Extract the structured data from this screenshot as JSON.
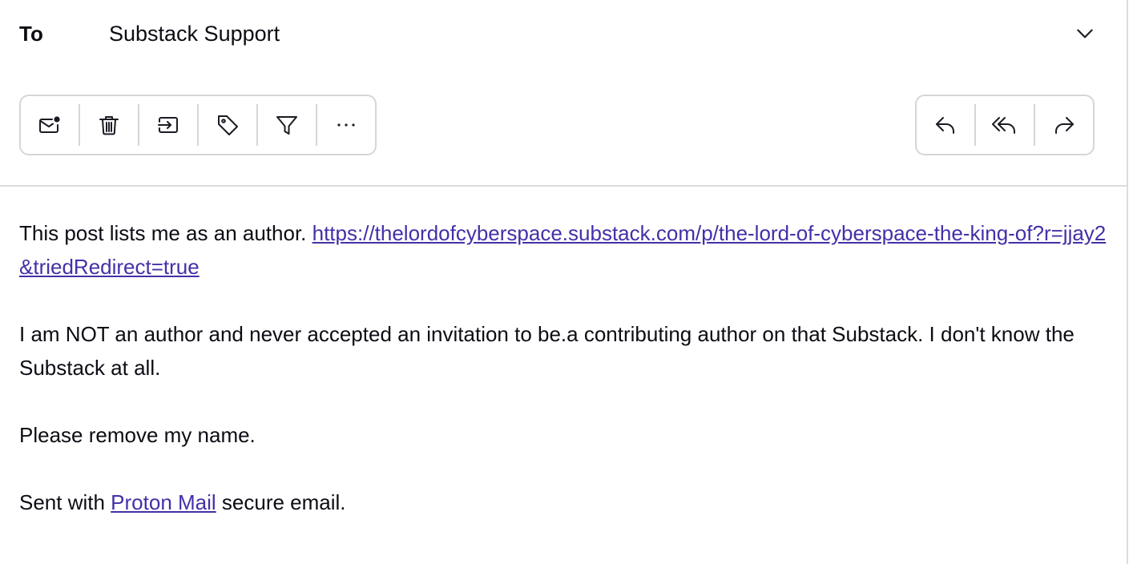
{
  "header": {
    "to_label": "To",
    "to_value": "Substack Support",
    "expand_icon": "chevron-down-icon"
  },
  "toolbar_left": [
    {
      "name": "mark-unread-button",
      "icon": "envelope-dot-icon",
      "label": "Mark as unread"
    },
    {
      "name": "trash-button",
      "icon": "trash-icon",
      "label": "Move to trash"
    },
    {
      "name": "move-button",
      "icon": "move-to-folder-icon",
      "label": "Move to"
    },
    {
      "name": "label-button",
      "icon": "tag-icon",
      "label": "Label as"
    },
    {
      "name": "filter-button",
      "icon": "filter-icon",
      "label": "Filter"
    },
    {
      "name": "more-button",
      "icon": "more-dots-icon",
      "label": "More"
    }
  ],
  "toolbar_right": [
    {
      "name": "reply-button",
      "icon": "reply-icon",
      "label": "Reply"
    },
    {
      "name": "reply-all-button",
      "icon": "reply-all-icon",
      "label": "Reply all"
    },
    {
      "name": "forward-button",
      "icon": "forward-icon",
      "label": "Forward"
    }
  ],
  "message": {
    "p1_text": "This post lists me as an author. ",
    "p1_link": "https://thelordofcyberspace.substack.com/p/the-lord-of-cyberspace-the-king-of?r=jjay2&triedRedirect=true",
    "p2": "I am NOT an author and never accepted an invitation to be.a contributing author on that Substack. I don't know the Substack at all.",
    "p3": "Please remove my name.",
    "signature_prefix": "Sent with ",
    "signature_link": "Proton Mail",
    "signature_suffix": " secure email."
  },
  "colors": {
    "link": "#4330a8",
    "border": "#d6d6d6",
    "text": "#0c0c14"
  }
}
